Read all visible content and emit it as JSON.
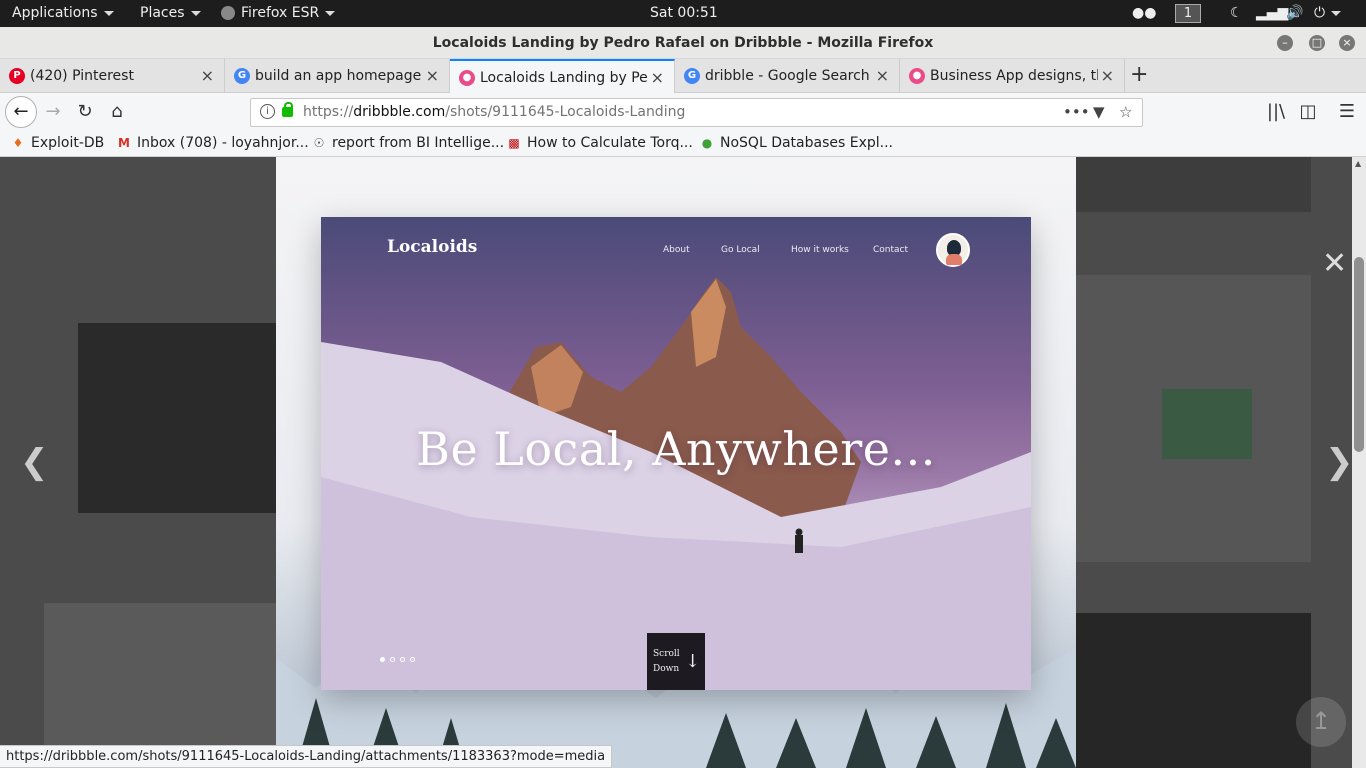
{
  "topbar": {
    "applications": "Applications",
    "places": "Places",
    "app_name": "Firefox ESR",
    "clock": "Sat 00:51",
    "workspace": "1"
  },
  "window": {
    "title": "Localoids Landing by Pedro Rafael on Dribbble - Mozilla Firefox"
  },
  "tabs": [
    {
      "label": "(420) Pinterest",
      "favicon": "pinterest-icon",
      "color": "#e60023"
    },
    {
      "label": "build an app homepage -",
      "favicon": "google-icon",
      "color": "#4285f4"
    },
    {
      "label": "Localoids Landing by Pedro",
      "favicon": "dribbble-icon",
      "color": "#ea4c89",
      "active": true
    },
    {
      "label": "dribble - Google Search",
      "favicon": "google-icon",
      "color": "#4285f4"
    },
    {
      "label": "Business App designs, the",
      "favicon": "dribbble-icon",
      "color": "#ea4c89"
    }
  ],
  "urlbar": {
    "prefix": "https://",
    "host": "dribbble.com",
    "path": "/shots/9111645-Localoids-Landing"
  },
  "bookmarks": [
    {
      "label": "Exploit-DB",
      "icon": "exploitdb-icon"
    },
    {
      "label": "Inbox (708) - loyahnjor...",
      "icon": "gmail-icon"
    },
    {
      "label": "report from BI Intellige...",
      "icon": "globe-icon"
    },
    {
      "label": "How to Calculate Torq...",
      "icon": "site-icon"
    },
    {
      "label": "NoSQL Databases Expl...",
      "icon": "leaf-icon"
    }
  ],
  "shot": {
    "logo": "Localoids",
    "nav": [
      "About",
      "Go Local",
      "How it works",
      "Contact"
    ],
    "headline": "Be Local, Anywhere...",
    "scroll_line1": "Scroll",
    "scroll_line2": "Down",
    "slide_count": 4,
    "active_slide": 1
  },
  "status": {
    "url": "https://dribbble.com/shots/9111645-Localoids-Landing/attachments/1183363?mode=media"
  }
}
